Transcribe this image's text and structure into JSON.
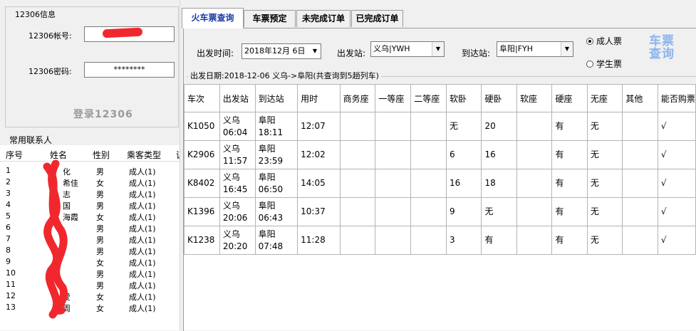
{
  "login": {
    "group_title": "12306信息",
    "account_label": "12306帐号:",
    "password_label": "12306密码:",
    "password_value": "********",
    "login_button": "登录12306"
  },
  "contacts": {
    "title": "常用联系人",
    "columns": [
      "序号",
      "姓名",
      "性别",
      "乘客类型",
      "证"
    ],
    "rows": [
      {
        "no": "1",
        "name": "化",
        "gender": "男",
        "type": "成人(1)"
      },
      {
        "no": "2",
        "name": "希佳",
        "gender": "女",
        "type": "成人(1)"
      },
      {
        "no": "3",
        "name": "志",
        "gender": "男",
        "type": "成人(1)"
      },
      {
        "no": "4",
        "name": "国",
        "gender": "男",
        "type": "成人(1)"
      },
      {
        "no": "5",
        "name": "海霞",
        "gender": "女",
        "type": "成人(1)"
      },
      {
        "no": "6",
        "name": "",
        "gender": "男",
        "type": "成人(1)"
      },
      {
        "no": "7",
        "name": "",
        "gender": "男",
        "type": "成人(1)"
      },
      {
        "no": "8",
        "name": "",
        "gender": "男",
        "type": "成人(1)"
      },
      {
        "no": "9",
        "name": "",
        "gender": "女",
        "type": "成人(1)"
      },
      {
        "no": "10",
        "name": "",
        "gender": "男",
        "type": "成人(1)"
      },
      {
        "no": "11",
        "name": "",
        "gender": "男",
        "type": "成人(1)"
      },
      {
        "no": "12",
        "name": "爱",
        "gender": "女",
        "type": "成人(1)"
      },
      {
        "no": "13",
        "name": "周",
        "gender": "女",
        "type": "成人(1)"
      }
    ]
  },
  "tabs": [
    "火车票查询",
    "车票预定",
    "未完成订单",
    "已完成订单"
  ],
  "query": {
    "date_label": "出发时间:",
    "date_value": "2018年12月 6日",
    "from_label": "出发站:",
    "from_value": "义乌|YWH",
    "to_label": "到达站:",
    "to_value": "阜阳|FYH",
    "adult_label": "成人票",
    "student_label": "学生票",
    "query_button_line1": "车票",
    "query_button_line2": "查询",
    "info_text": "出发日期:2018-12-06  义乌->阜阳(共查询到5趟列车)"
  },
  "table": {
    "columns": [
      "车次",
      "出发站",
      "到达站",
      "用时",
      "商务座",
      "一等座",
      "二等座",
      "软卧",
      "硬卧",
      "软座",
      "硬座",
      "无座",
      "其他",
      "能否购票"
    ],
    "rows": [
      {
        "train": "K1050",
        "from": "义乌",
        "dep": "06:04",
        "to": "阜阳",
        "arr": "18:11",
        "duration": "12:07",
        "business": "",
        "first": "",
        "second": "",
        "soft_sleeper": "无",
        "hard_sleeper": "20",
        "soft_seat": "",
        "hard_seat": "有",
        "no_seat": "无",
        "other": "",
        "can_buy": "√"
      },
      {
        "train": "K2906",
        "from": "义乌",
        "dep": "11:57",
        "to": "阜阳",
        "arr": "23:59",
        "duration": "12:02",
        "business": "",
        "first": "",
        "second": "",
        "soft_sleeper": "6",
        "hard_sleeper": "16",
        "soft_seat": "",
        "hard_seat": "有",
        "no_seat": "无",
        "other": "",
        "can_buy": "√"
      },
      {
        "train": "K8402",
        "from": "义乌",
        "dep": "16:45",
        "to": "阜阳",
        "arr": "06:50",
        "duration": "14:05",
        "business": "",
        "first": "",
        "second": "",
        "soft_sleeper": "16",
        "hard_sleeper": "18",
        "soft_seat": "",
        "hard_seat": "有",
        "no_seat": "无",
        "other": "",
        "can_buy": "√"
      },
      {
        "train": "K1396",
        "from": "义乌",
        "dep": "20:06",
        "to": "阜阳",
        "arr": "06:43",
        "duration": "10:37",
        "business": "",
        "first": "",
        "second": "",
        "soft_sleeper": "9",
        "hard_sleeper": "无",
        "soft_seat": "",
        "hard_seat": "有",
        "no_seat": "无",
        "other": "",
        "can_buy": "√"
      },
      {
        "train": "K1238",
        "from": "义乌",
        "dep": "20:20",
        "to": "阜阳",
        "arr": "07:48",
        "duration": "11:28",
        "business": "",
        "first": "",
        "second": "",
        "soft_sleeper": "3",
        "hard_sleeper": "有",
        "soft_seat": "",
        "hard_seat": "有",
        "no_seat": "无",
        "other": "",
        "can_buy": "√"
      }
    ]
  },
  "colors": {
    "active_tab_text": "#1a3aa8",
    "query_button": "#8ab4f0",
    "redaction": "#f0282e"
  },
  "icons": {
    "dropdown": "chevron-down-icon",
    "radio": "radio-icon"
  }
}
